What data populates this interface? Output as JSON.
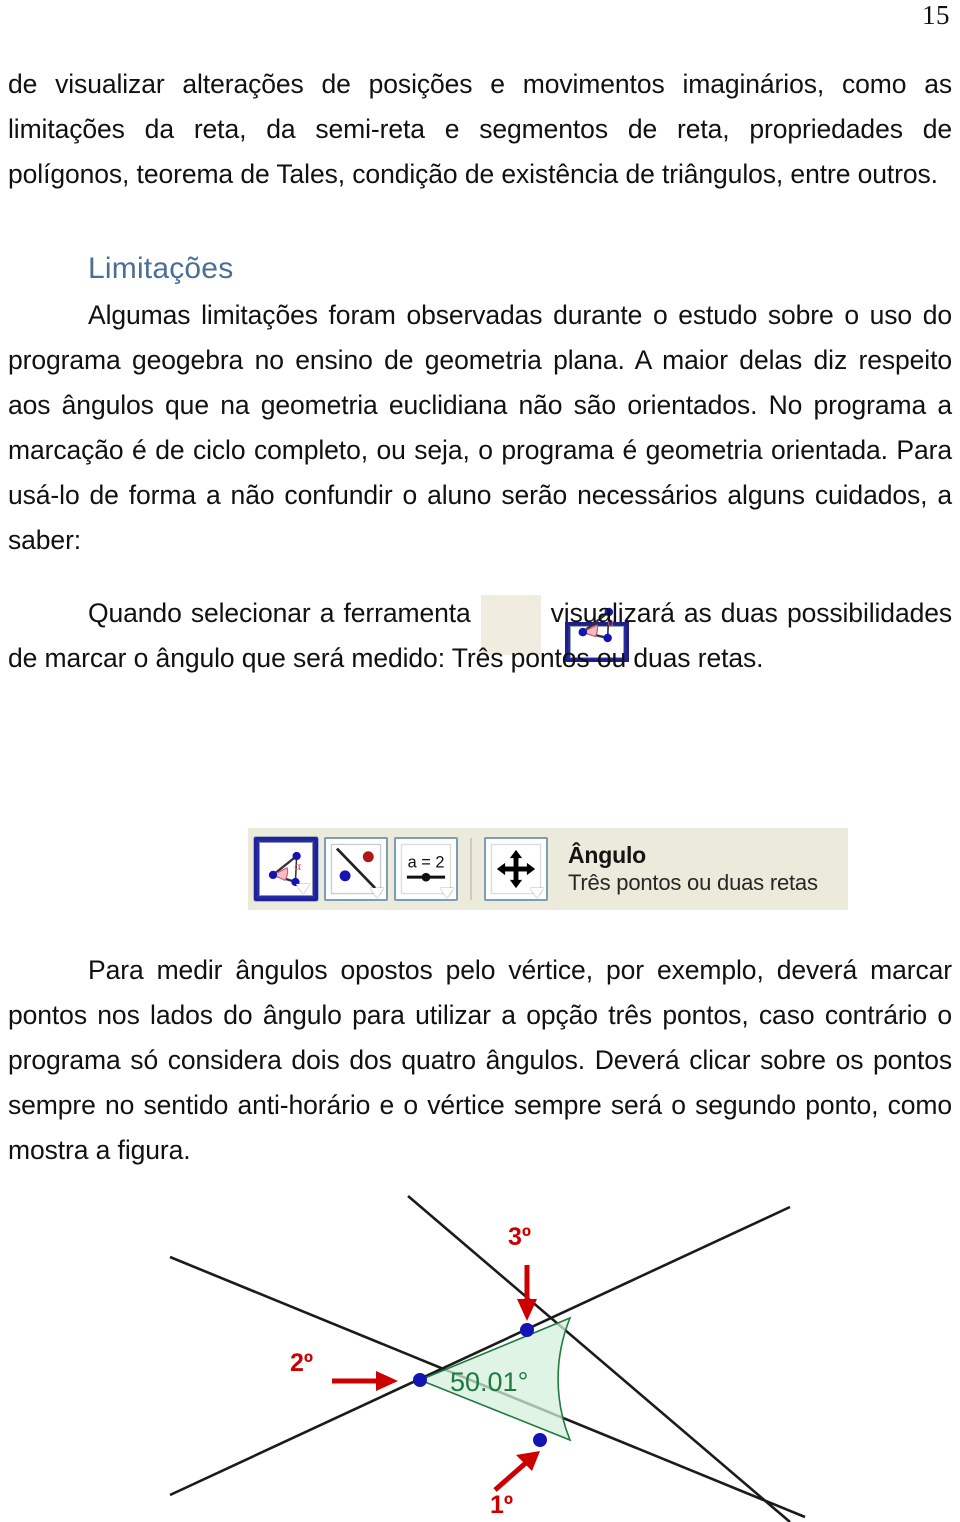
{
  "page": {
    "number": "15",
    "heading_color": "#4a6f97"
  },
  "paragraphs": {
    "p1": "de visualizar alterações de posições e movimentos imaginários, como as limitações da reta, da semi-reta e segmentos de reta, propriedades de polígonos, teorema de Tales, condição de existência de triângulos, entre outros.",
    "heading_limitacoes": "Limitações",
    "p2": "Algumas limitações foram observadas durante o estudo sobre o uso do programa geogebra no ensino de geometria plana. A maior delas diz respeito aos ângulos que na geometria euclidiana não são orientados. No programa a marcação é de ciclo completo, ou seja, o programa é geometria orientada. Para usá-lo de forma a não confundir o aluno serão necessários alguns cuidados, a saber:",
    "p3_before_icon": "Quando selecionar a ferramenta",
    "p3_after_icon": "visualizará as duas possibilidades de marcar o ângulo que será medido: Três pontos ou duas retas.",
    "p4": "Para medir ângulos opostos pelo vértice, por exemplo, deverá marcar pontos nos lados do ângulo para utilizar a opção três pontos, caso contrário o programa só considera dois dos quatro ângulos. Deverá clicar sobre os pontos sempre no sentido anti-horário e o vértice sempre será o segundo ponto, como mostra a figura."
  },
  "toolbar": {
    "title": "Ângulo",
    "subtitle": "Três pontos ou duas retas",
    "background": "#eceadb",
    "selected_index": 0,
    "buttons": [
      {
        "name": "angle-tool",
        "icon": "angle-triangle-icon",
        "label": "",
        "selected": true
      },
      {
        "name": "distance-tool",
        "icon": "distance-points-icon",
        "label": "",
        "selected": false
      },
      {
        "name": "slider-tool",
        "icon": "slider-icon",
        "label": "a = 2",
        "selected": false
      },
      {
        "name": "move-tool",
        "icon": "move-arrows-icon",
        "label": "",
        "selected": false
      }
    ]
  },
  "inline_icon": {
    "name": "angle-tool-icon",
    "alpha_label": "α"
  },
  "figure": {
    "angle_label": "50.01°",
    "angle_color": "#1f7a3f",
    "annotation_color": "#cc0000",
    "point_color": "#1414b4",
    "annotations": [
      {
        "label": "1º",
        "arrow": "up-right"
      },
      {
        "label": "2º",
        "arrow": "right"
      },
      {
        "label": "3º",
        "arrow": "down"
      }
    ]
  }
}
